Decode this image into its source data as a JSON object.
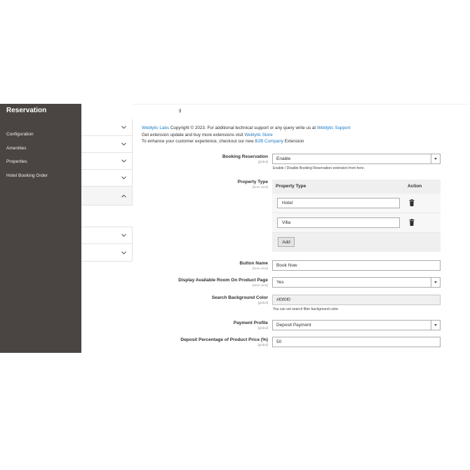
{
  "sidebar": {
    "title": "Reservation",
    "items": [
      {
        "label": "Configuration"
      },
      {
        "label": "Amenities"
      },
      {
        "label": "Properties"
      },
      {
        "label": "Hotel Booking Order"
      }
    ]
  },
  "info": {
    "line1_link1": "Weblytic Labs",
    "line1_text": " Copyright © 2023. For additional technical support or any query write us at ",
    "line1_link2": "Weblytic Support",
    "line2_text": "Get extension update and buy more extensions visit ",
    "line2_link": "Weblytic Store",
    "line3_text1": "To enhance your customer experience, checkout our new ",
    "line3_link": "B2B Company",
    "line3_text2": " Extension"
  },
  "form": {
    "booking_reservation": {
      "label": "Booking Reservation",
      "scope": "[global]",
      "value": "Enable",
      "note": "Enable / Disable Booking Reservation extension from here."
    },
    "property_type": {
      "label": "Property Type",
      "scope": "[store view]",
      "col_property": "Property Type",
      "col_action": "Action",
      "rows": [
        {
          "value": "Hotel"
        },
        {
          "value": "Villa"
        }
      ],
      "add_label": "Add"
    },
    "button_name": {
      "label": "Button Name",
      "scope": "[store view]",
      "value": "Book Now"
    },
    "display_available": {
      "label": "Display Available Room On Product Page",
      "scope": "[store view]",
      "value": "Yes"
    },
    "search_bg": {
      "label": "Search Background Color",
      "scope": "[global]",
      "value": "#f0f0f0",
      "note": "You can set search filter background color."
    },
    "payment_profile": {
      "label": "Payment Profile",
      "scope": "[global]",
      "value": "Deposit Payment"
    },
    "deposit_percentage": {
      "label": "Deposit Percentage of Product Price (%)",
      "scope": "[global]",
      "value": "50"
    }
  },
  "colors": {
    "sidebar_bg": "#4a4542",
    "link": "#1979c3"
  }
}
